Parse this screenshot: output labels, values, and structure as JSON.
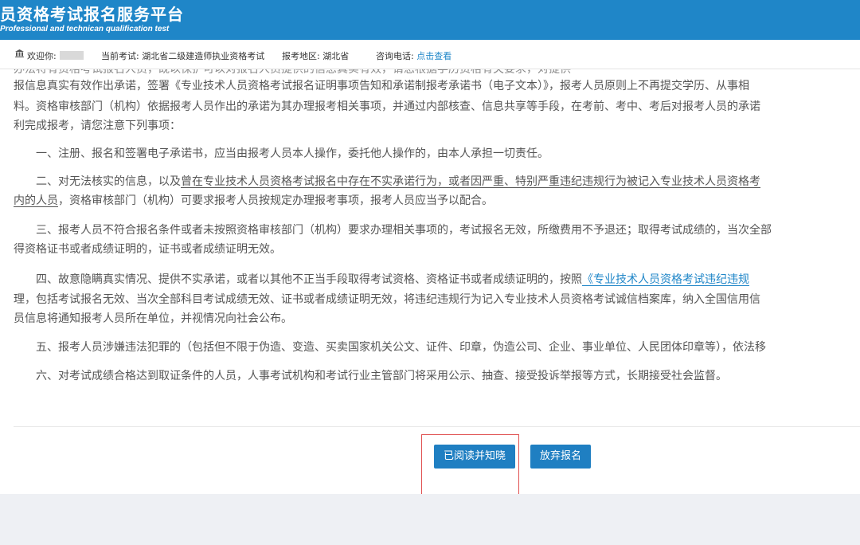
{
  "header": {
    "title": "员资格考试报名服务平台",
    "subtitle": "Professional and technican qualification test"
  },
  "infobar": {
    "welcome_label": "欢迎你:",
    "current_exam_label": "当前考试:",
    "current_exam_value": "湖北省二级建造师执业资格考试",
    "region_label": "报考地区:",
    "region_value": "湖北省",
    "phone_label": "咨询电话:",
    "phone_link": "点击查看",
    "icons": {
      "home": "home-icon"
    }
  },
  "notice": {
    "lines": {
      "clipped": "办法将有资格考试报名人员，既以保护可以对报名人员提供的信息真实有效，请您根据学历资格有关要求，对提供",
      "l1": "报信息真实有效作出承诺，签署《专业技术人员资格考试报名证明事项告知和承诺制报考承诺书（电子文本）》，报考人员原则上不再提交学历、从事相",
      "l2": "料。资格审核部门（机构）依据报考人员作出的承诺为其办理报考相关事项，并通过内部核查、信息共享等手段，在考前、考中、考后对报考人员的承诺",
      "l3": "利完成报考，请您注意下列事项：",
      "p1": "一、注册、报名和签署电子承诺书，应当由报考人员本人操作，委托他人操作的，由本人承担一切责任。",
      "p2_a": "二、对无法核实的信息，以及",
      "p2_u": "曾在专业技术人员资格考试报名中存在不实承诺行为，或者因严重、特别严重违纪违规行为被记入专业技术人员资格考",
      "p2_u2": "内的人员",
      "p2_b": "，资格审核部门（机构）可要求报考人员按规定办理报考事项，报考人员应当予以配合。",
      "p3_a": "三、报考人员不符合报名条件或者未按照资格审核部门（机构）要求办理相关事项的，考试报名无效，所缴费用不予退还；取得考试成绩的，当次全部",
      "p3_b": "得资格证书或者成绩证明的，证书或者成绩证明无效。",
      "p4_a": "四、故意隐瞒真实情况、提供不实承诺，或者以其他不正当手段取得考试资格、资格证书或者成绩证明的，按照",
      "p4_link": "《专业技术人员资格考试违纪违规",
      "p4_b": "理，包括考试报名无效、当次全部科目考试成绩无效、证书或者成绩证明无效，将违纪违规行为记入专业技术人员资格考试诚信档案库，纳入全国信用信",
      "p4_c": "员信息将通知报考人员所在单位，并视情况向社会公布。",
      "p5": "五、报考人员涉嫌违法犯罪的（包括但不限于伪造、变造、买卖国家机关公文、证件、印章，伪造公司、企业、事业单位、人民团体印章等），依法移",
      "p6": "六、对考试成绩合格达到取证条件的人员，人事考试机构和考试行业主管部门将采用公示、抽查、接受投诉举报等方式，长期接受社会监督。"
    }
  },
  "actions": {
    "agree_label": "已阅读并知晓",
    "abandon_label": "放弃报名"
  },
  "colors": {
    "header_bg": "#1f86c8",
    "button_bg": "#1f7fc2",
    "highlight_border": "#e05050"
  }
}
